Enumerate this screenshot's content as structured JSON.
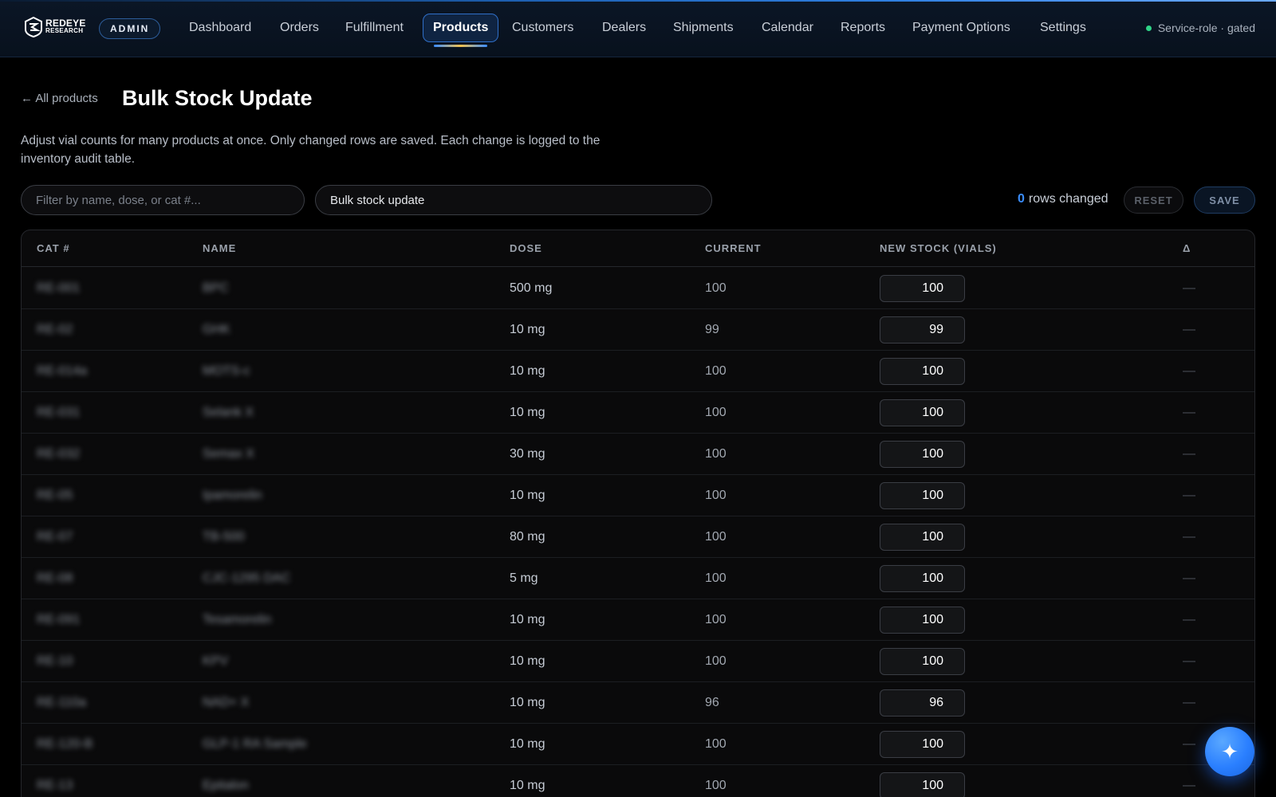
{
  "brand": {
    "line1": "REDEYE",
    "line2": "RESEARCH"
  },
  "admin_badge": "ADMIN",
  "nav": [
    {
      "label": "Dashboard",
      "active": false
    },
    {
      "label": "Orders",
      "active": false
    },
    {
      "label": "Fulfillment",
      "active": false
    },
    {
      "label": "Products",
      "active": true
    },
    {
      "label": "Customers",
      "active": false
    },
    {
      "label": "Dealers",
      "active": false
    },
    {
      "label": "Shipments",
      "active": false
    },
    {
      "label": "Calendar",
      "active": false
    },
    {
      "label": "Reports",
      "active": false
    },
    {
      "label": "Payment Options",
      "active": false
    },
    {
      "label": "Settings",
      "active": false
    }
  ],
  "status": {
    "label": "Service-role · gated",
    "color": "#2fd487"
  },
  "page": {
    "back_label": "← All products",
    "title": "Bulk Stock Update",
    "description": "Adjust vial counts for many products at once. Only changed rows are saved. Each change is logged to the inventory audit table."
  },
  "controls": {
    "filter_placeholder": "Filter by name, dose, or cat #...",
    "note_value": "Bulk stock update",
    "rows_changed_count": "0",
    "rows_changed_label": "rows changed",
    "reset_label": "RESET",
    "save_label": "SAVE"
  },
  "table": {
    "headers": {
      "cat": "CAT #",
      "name": "NAME",
      "dose": "DOSE",
      "current": "CURRENT",
      "new_stock": "NEW STOCK (VIALS)",
      "delta": "Δ"
    },
    "rows": [
      {
        "cat": "RE-001",
        "name": "BPC",
        "dose": "500 mg",
        "current": "100",
        "new_stock": "100",
        "delta": "—"
      },
      {
        "cat": "RE-02",
        "name": "GHK",
        "dose": "10 mg",
        "current": "99",
        "new_stock": "99",
        "delta": "—"
      },
      {
        "cat": "RE-014a",
        "name": "MOTS-c",
        "dose": "10 mg",
        "current": "100",
        "new_stock": "100",
        "delta": "—"
      },
      {
        "cat": "RE-031",
        "name": "Selank X",
        "dose": "10 mg",
        "current": "100",
        "new_stock": "100",
        "delta": "—"
      },
      {
        "cat": "RE-032",
        "name": "Semax X",
        "dose": "30 mg",
        "current": "100",
        "new_stock": "100",
        "delta": "—"
      },
      {
        "cat": "RE-05",
        "name": "Ipamorelin",
        "dose": "10 mg",
        "current": "100",
        "new_stock": "100",
        "delta": "—"
      },
      {
        "cat": "RE-07",
        "name": "TB-500",
        "dose": "80 mg",
        "current": "100",
        "new_stock": "100",
        "delta": "—"
      },
      {
        "cat": "RE-08",
        "name": "CJC-1295 DAC",
        "dose": "5 mg",
        "current": "100",
        "new_stock": "100",
        "delta": "—"
      },
      {
        "cat": "RE-091",
        "name": "Tesamorelin",
        "dose": "10 mg",
        "current": "100",
        "new_stock": "100",
        "delta": "—"
      },
      {
        "cat": "RE-10",
        "name": "KPV",
        "dose": "10 mg",
        "current": "100",
        "new_stock": "100",
        "delta": "—"
      },
      {
        "cat": "RE-110a",
        "name": "NAD+ X",
        "dose": "10 mg",
        "current": "96",
        "new_stock": "96",
        "delta": "—"
      },
      {
        "cat": "RE-120-B",
        "name": "GLP-1 RA Sample",
        "dose": "10 mg",
        "current": "100",
        "new_stock": "100",
        "delta": "—"
      },
      {
        "cat": "RE-13",
        "name": "Epitalon",
        "dose": "10 mg",
        "current": "100",
        "new_stock": "100",
        "delta": "—"
      }
    ]
  },
  "fab": {
    "icon": "sparkle-icon",
    "glyph": "✦",
    "color": "#2a7fff"
  }
}
